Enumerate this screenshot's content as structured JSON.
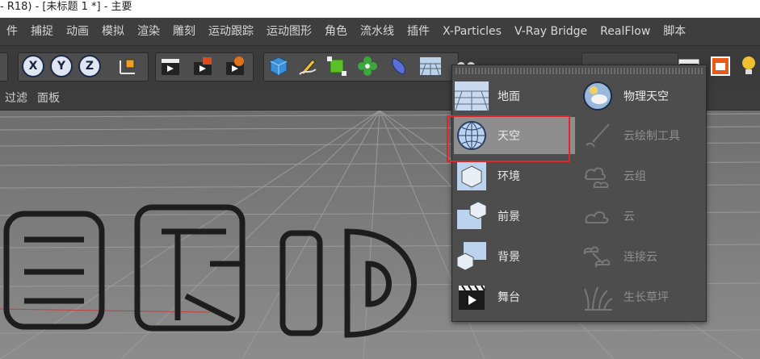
{
  "window": {
    "title": "- R18) - [未标题 1 *] - 主要"
  },
  "menu": [
    "件",
    "捕捉",
    "动画",
    "模拟",
    "渲染",
    "雕刻",
    "运动跟踪",
    "运动图形",
    "角色",
    "流水线",
    "插件",
    "X-Particles",
    "V-Ray Bridge",
    "RealFlow",
    "脚本"
  ],
  "toolbar": {
    "axis_x": "X",
    "axis_y": "Y",
    "axis_z": "Z"
  },
  "subbar": {
    "filter": "过滤",
    "panel": "面板"
  },
  "popup": {
    "left": [
      {
        "label": "地面",
        "icon": "floor-icon"
      },
      {
        "label": "天空",
        "icon": "sky-globe-icon",
        "selected": true
      },
      {
        "label": "环境",
        "icon": "environment-cube-icon"
      },
      {
        "label": "前景",
        "icon": "foreground-icon"
      },
      {
        "label": "背景",
        "icon": "background-icon"
      },
      {
        "label": "舞台",
        "icon": "stage-clapper-icon"
      }
    ],
    "right": [
      {
        "label": "物理天空",
        "icon": "physical-sky-icon",
        "enabled": true
      },
      {
        "label": "云绘制工具",
        "icon": "cloud-paint-icon",
        "enabled": false
      },
      {
        "label": "云组",
        "icon": "cloud-group-icon",
        "enabled": false
      },
      {
        "label": "云",
        "icon": "cloud-icon",
        "enabled": false
      },
      {
        "label": "连接云",
        "icon": "connect-cloud-icon",
        "enabled": false
      },
      {
        "label": "生长草坪",
        "icon": "grass-icon",
        "enabled": false
      }
    ]
  },
  "colors": {
    "highlight": "#e0262b",
    "menubar": "#3e3e3e",
    "viewport": "#7a7a7a"
  }
}
